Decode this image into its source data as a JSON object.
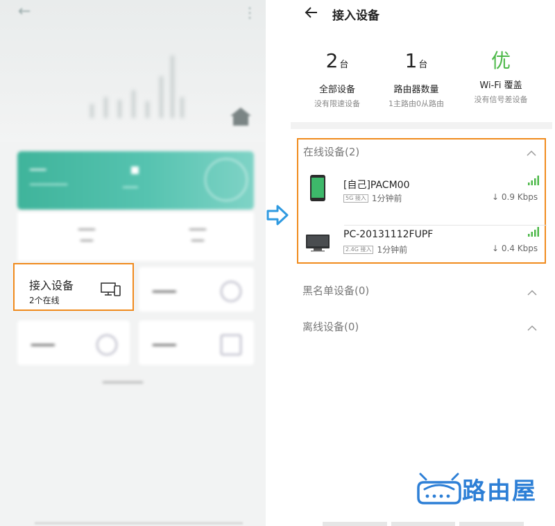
{
  "left_panel": {
    "access_tile": {
      "title": "接入设备",
      "subtitle": "2个在线",
      "icon": "devices-icon"
    }
  },
  "right_panel": {
    "header": {
      "title": "接入设备",
      "back_icon": "arrow-left-icon"
    },
    "stats": [
      {
        "value": "2",
        "unit": "台",
        "label": "全部设备",
        "sub": "没有限速设备"
      },
      {
        "value": "1",
        "unit": "台",
        "label": "路由器数量",
        "sub": "1主路由0从路由"
      },
      {
        "value": "优",
        "unit": "",
        "label": "Wi-Fi 覆盖",
        "sub": "没有信号差设备"
      }
    ],
    "sections": {
      "online": {
        "title": "在线设备(2)"
      },
      "blacklist": {
        "title": "黑名单设备(0)"
      },
      "offline": {
        "title": "离线设备(0)"
      }
    },
    "devices": [
      {
        "name": "[自己]PACM00",
        "band": "5G 接入",
        "time": "1分钟前",
        "speed": "↓ 0.9 Kbps",
        "icon": "phone-icon"
      },
      {
        "name": "PC-20131112FUPF",
        "band": "2.4G 接入",
        "time": "1分钟前",
        "speed": "↓ 0.4 Kbps",
        "icon": "monitor-icon"
      }
    ]
  },
  "logo": {
    "text": "路由屋"
  },
  "colors": {
    "highlight": "#f08a1c",
    "accent_green": "#4cb848",
    "signal": "#4cb848",
    "brand_blue": "#2d7fd6",
    "arrow_blue": "#2f9ae0"
  }
}
